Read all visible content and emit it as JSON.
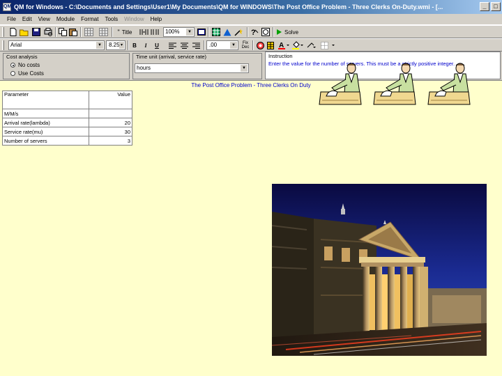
{
  "window": {
    "title": "QM for Windows - C:\\Documents and Settings\\User1\\My Documents\\QM for WINDOWS\\The Post Office Problem - Three Clerks On-Duty.wmi - [...",
    "app_icon": "QM",
    "minimize_icon": "minimize-icon",
    "maximize_icon": "maximize-icon"
  },
  "menu": {
    "items": [
      "File",
      "Edit",
      "View",
      "Module",
      "Format",
      "Tools",
      "Window",
      "Help"
    ]
  },
  "toolbar1": {
    "title_btn": "Title",
    "zoom": "100%",
    "solve_label": "Solve"
  },
  "toolbar2": {
    "font": "Arial",
    "font_size": "8.25",
    "decimals": ".00",
    "fixed_label": "Fix",
    "decimal_label": "Dec",
    "bold": "B",
    "italic": "I",
    "underline": "U"
  },
  "cost_panel": {
    "title": "Cost analysis",
    "options": [
      "No costs",
      "Use Costs"
    ]
  },
  "time_panel": {
    "title": "Time unit (arrival, service rate)",
    "value": "hours"
  },
  "instruction_panel": {
    "title": "Instruction",
    "text": "Enter the value for the number of servers. This must be a strictly positive integer."
  },
  "document": {
    "title": "The Post Office Problem - Three Clerks On Duty"
  },
  "table": {
    "headers": [
      "Parameter",
      "Value"
    ],
    "rows": [
      {
        "label": "M/M/s",
        "value": ""
      },
      {
        "label": "Arrival rate(lambda)",
        "value": "20"
      },
      {
        "label": "Service rate(mu)",
        "value": "30"
      },
      {
        "label": "Number of servers",
        "value": "3"
      }
    ]
  },
  "colors": {
    "titlebar": "#0a246a",
    "chrome": "#d4d0c8",
    "document_bg": "#ffffcc",
    "instruction_text": "#0000cc"
  }
}
